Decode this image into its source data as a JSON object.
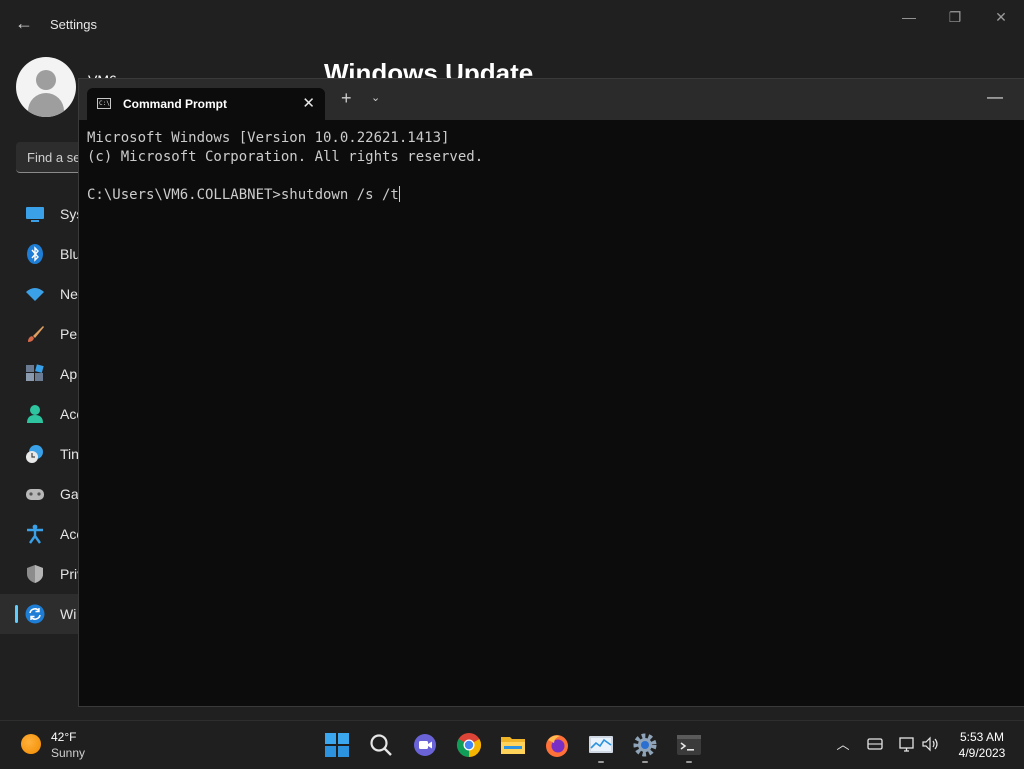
{
  "settings": {
    "title": "Settings",
    "user_name": "VM6",
    "page_heading": "Windows Update",
    "search_placeholder": "Find a se",
    "nav": [
      {
        "label": "Sys",
        "icon": "system-icon"
      },
      {
        "label": "Blu",
        "icon": "bluetooth-icon"
      },
      {
        "label": "Ne",
        "icon": "network-icon"
      },
      {
        "label": "Per",
        "icon": "personalization-brush-icon"
      },
      {
        "label": "Ap",
        "icon": "apps-icon"
      },
      {
        "label": "Acc",
        "icon": "accounts-icon"
      },
      {
        "label": "Tin",
        "icon": "time-language-icon"
      },
      {
        "label": "Ga",
        "icon": "gaming-icon"
      },
      {
        "label": "Acc",
        "icon": "accessibility-icon"
      },
      {
        "label": "Priv",
        "icon": "privacy-shield-icon"
      },
      {
        "label": "Wi",
        "icon": "windows-update-icon",
        "active": true
      }
    ]
  },
  "terminal": {
    "tab_label": "Command Prompt",
    "tab_icon": "command-prompt-icon",
    "tab_icon_text": "C:\\",
    "new_tab_label": "+",
    "console_lines": [
      "Microsoft Windows [Version 10.0.22621.1413]",
      "(c) Microsoft Corporation. All rights reserved.",
      "",
      "C:\\Users\\VM6.COLLABNET>shutdown /s /t"
    ]
  },
  "taskbar": {
    "weather": {
      "temp": "42°F",
      "condition": "Sunny",
      "icon": "sun-icon"
    },
    "apps": [
      {
        "name": "start-button",
        "icon": "windows-logo-icon"
      },
      {
        "name": "search-button",
        "icon": "search-icon"
      },
      {
        "name": "teams-chat-button",
        "icon": "chat-camera-icon"
      },
      {
        "name": "chrome-button",
        "icon": "chrome-icon"
      },
      {
        "name": "file-explorer-button",
        "icon": "folder-icon"
      },
      {
        "name": "firefox-button",
        "icon": "firefox-icon"
      },
      {
        "name": "performance-monitor-button",
        "icon": "monitor-chart-icon",
        "running": true
      },
      {
        "name": "settings-button",
        "icon": "gear-icon",
        "running": true
      },
      {
        "name": "terminal-button",
        "icon": "terminal-icon",
        "running": true
      }
    ],
    "clock": {
      "time": "5:53 AM",
      "date": "4/9/2023"
    }
  },
  "colors": {
    "accent": "#60cdff",
    "console_bg": "#0c0c0c",
    "console_fg": "#cccccc"
  }
}
